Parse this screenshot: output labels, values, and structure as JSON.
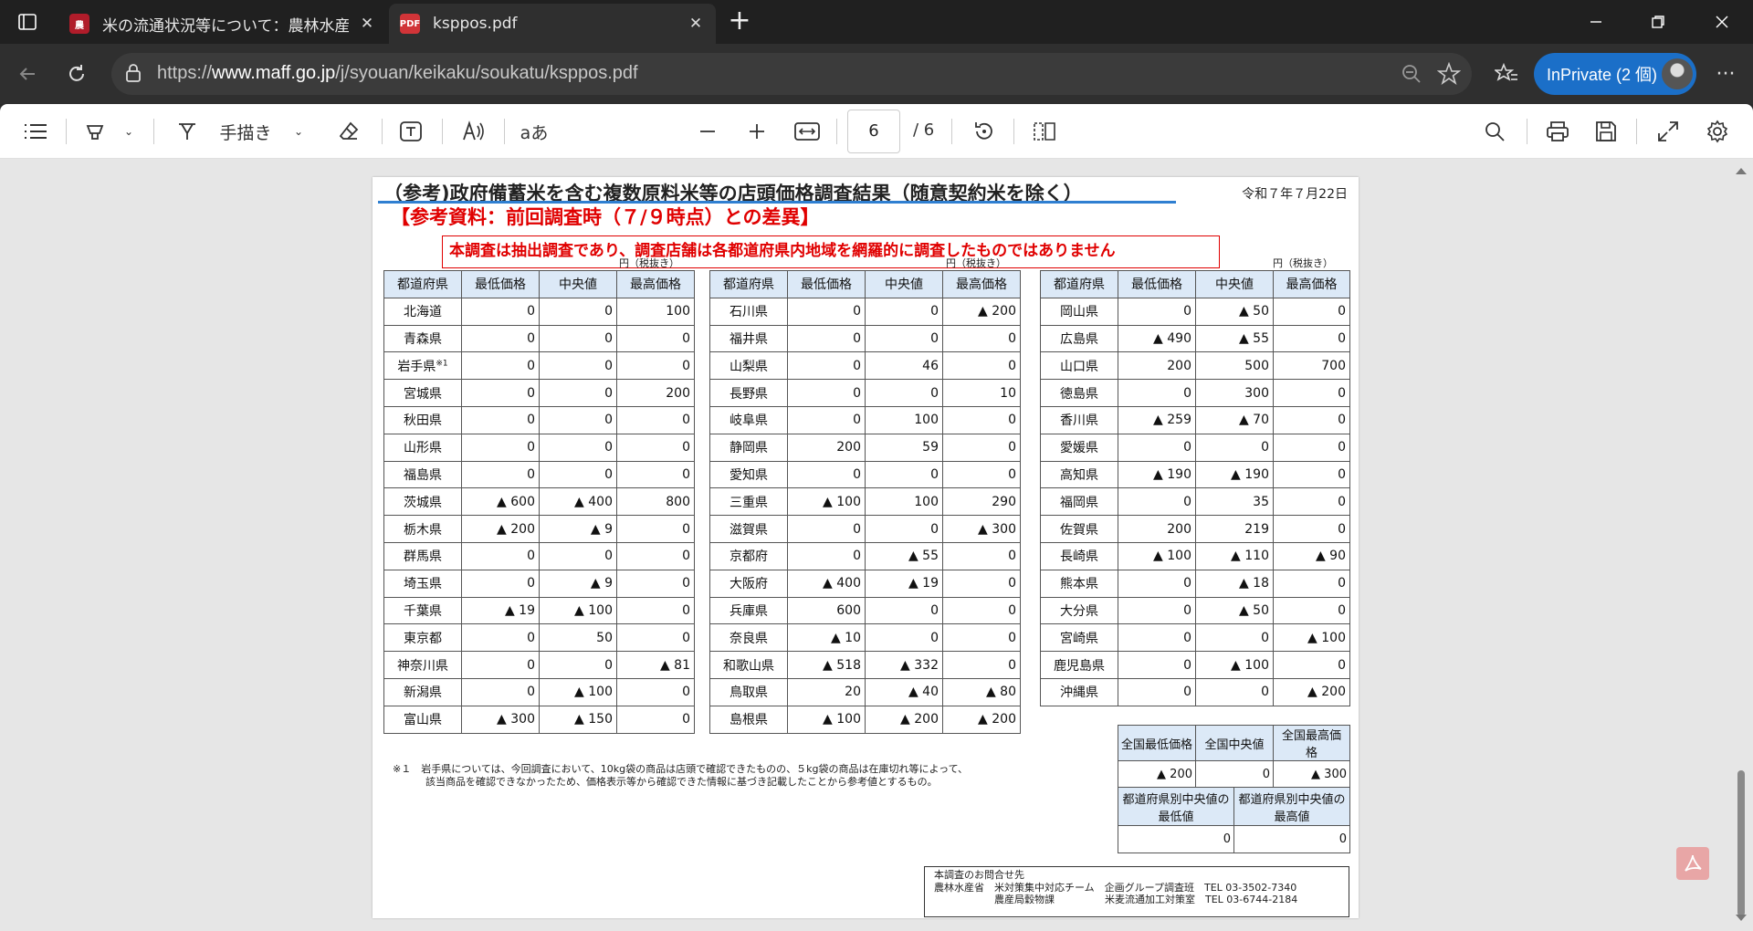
{
  "browser": {
    "tabs": [
      {
        "title": "米の流通状況等について：農林水産省",
        "active": false
      },
      {
        "title": "ksppos.pdf",
        "active": true
      }
    ],
    "url_prefix": "https://",
    "url_domain": "www.maff.go.jp",
    "url_path": "/j/syouan/keikaku/soukatu/ksppos.pdf",
    "inprivate_label": "InPrivate (2 個)",
    "accent_color": "#1b6fc8"
  },
  "pdf_toolbar": {
    "draw_label": "手描き",
    "read_aloud_label": "aあ",
    "current_page": "6",
    "total_pages": "/ 6"
  },
  "document": {
    "title": "（参考)政府備蓄米を含む複数原料米等の店頭価格調査結果（随意契約米を除く）",
    "date": "令和７年７月22日",
    "subtitle": "【参考資料：前回調査時（７/９時点）との差異】",
    "notice": "本調査は抽出調査であり、調査店舗は各都道府県内地域を網羅的に調査したものではありません",
    "unit": "円（税抜き）",
    "headers": [
      "都道府県",
      "最低価格",
      "中央値",
      "最高価格"
    ],
    "table1": [
      [
        "北海道",
        "0",
        "0",
        "100"
      ],
      [
        "青森県",
        "0",
        "0",
        "0"
      ],
      [
        "岩手県",
        "0",
        "0",
        "0"
      ],
      [
        "宮城県",
        "0",
        "0",
        "200"
      ],
      [
        "秋田県",
        "0",
        "0",
        "0"
      ],
      [
        "山形県",
        "0",
        "0",
        "0"
      ],
      [
        "福島県",
        "0",
        "0",
        "0"
      ],
      [
        "茨城県",
        "▲ 600",
        "▲ 400",
        "800"
      ],
      [
        "栃木県",
        "▲ 200",
        "▲ 9",
        "0"
      ],
      [
        "群馬県",
        "0",
        "0",
        "0"
      ],
      [
        "埼玉県",
        "0",
        "▲ 9",
        "0"
      ],
      [
        "千葉県",
        "▲ 19",
        "▲ 100",
        "0"
      ],
      [
        "東京都",
        "0",
        "50",
        "0"
      ],
      [
        "神奈川県",
        "0",
        "0",
        "▲ 81"
      ],
      [
        "新潟県",
        "0",
        "▲ 100",
        "0"
      ],
      [
        "富山県",
        "▲ 300",
        "▲ 150",
        "0"
      ]
    ],
    "iwate_note_mark": "※1",
    "table2": [
      [
        "石川県",
        "0",
        "0",
        "▲ 200"
      ],
      [
        "福井県",
        "0",
        "0",
        "0"
      ],
      [
        "山梨県",
        "0",
        "46",
        "0"
      ],
      [
        "長野県",
        "0",
        "0",
        "10"
      ],
      [
        "岐阜県",
        "0",
        "100",
        "0"
      ],
      [
        "静岡県",
        "200",
        "59",
        "0"
      ],
      [
        "愛知県",
        "0",
        "0",
        "0"
      ],
      [
        "三重県",
        "▲ 100",
        "100",
        "290"
      ],
      [
        "滋賀県",
        "0",
        "0",
        "▲ 300"
      ],
      [
        "京都府",
        "0",
        "▲ 55",
        "0"
      ],
      [
        "大阪府",
        "▲ 400",
        "▲ 19",
        "0"
      ],
      [
        "兵庫県",
        "600",
        "0",
        "0"
      ],
      [
        "奈良県",
        "▲ 10",
        "0",
        "0"
      ],
      [
        "和歌山県",
        "▲ 518",
        "▲ 332",
        "0"
      ],
      [
        "鳥取県",
        "20",
        "▲ 40",
        "▲ 80"
      ],
      [
        "島根県",
        "▲ 100",
        "▲ 200",
        "▲ 200"
      ]
    ],
    "table3": [
      [
        "岡山県",
        "0",
        "▲ 50",
        "0"
      ],
      [
        "広島県",
        "▲ 490",
        "▲ 55",
        "0"
      ],
      [
        "山口県",
        "200",
        "500",
        "700"
      ],
      [
        "徳島県",
        "0",
        "300",
        "0"
      ],
      [
        "香川県",
        "▲ 259",
        "▲ 70",
        "0"
      ],
      [
        "愛媛県",
        "0",
        "0",
        "0"
      ],
      [
        "高知県",
        "▲ 190",
        "▲ 190",
        "0"
      ],
      [
        "福岡県",
        "0",
        "35",
        "0"
      ],
      [
        "佐賀県",
        "200",
        "219",
        "0"
      ],
      [
        "長崎県",
        "▲ 100",
        "▲ 110",
        "▲ 90"
      ],
      [
        "熊本県",
        "0",
        "▲ 18",
        "0"
      ],
      [
        "大分県",
        "0",
        "▲ 50",
        "0"
      ],
      [
        "宮崎県",
        "0",
        "0",
        "▲ 100"
      ],
      [
        "鹿児島県",
        "0",
        "▲ 100",
        "0"
      ],
      [
        "沖縄県",
        "0",
        "0",
        "▲ 200"
      ]
    ],
    "national": {
      "headers": [
        "全国最低価格",
        "全国中央値",
        "全国最高価格"
      ],
      "values": [
        "▲ 200",
        "0",
        "▲ 300"
      ]
    },
    "pref_median": {
      "header_min": "都道府県別中央値の最低値",
      "header_max": "都道府県別中央値の最高値",
      "value_min": "0",
      "value_max": "0"
    },
    "footnote_mark": "※１",
    "footnote_line1": "岩手県については、今回調査において、10kg袋の商品は店頭で確認できたものの、５kg袋の商品は在庫切れ等によって、",
    "footnote_line2": "該当商品を確認できなかったため、価格表示等から確認できた情報に基づき記載したことから参考値とするもの。",
    "contact": {
      "heading": "本調査のお問合せ先",
      "line1": "農林水産省　米対策集中対応チーム　企画グループ調査班　TEL 03-3502-7340",
      "line2": "　　　　　　農産局穀物課　　　　　米麦流通加工対策室　TEL 03-6744-2184"
    }
  }
}
